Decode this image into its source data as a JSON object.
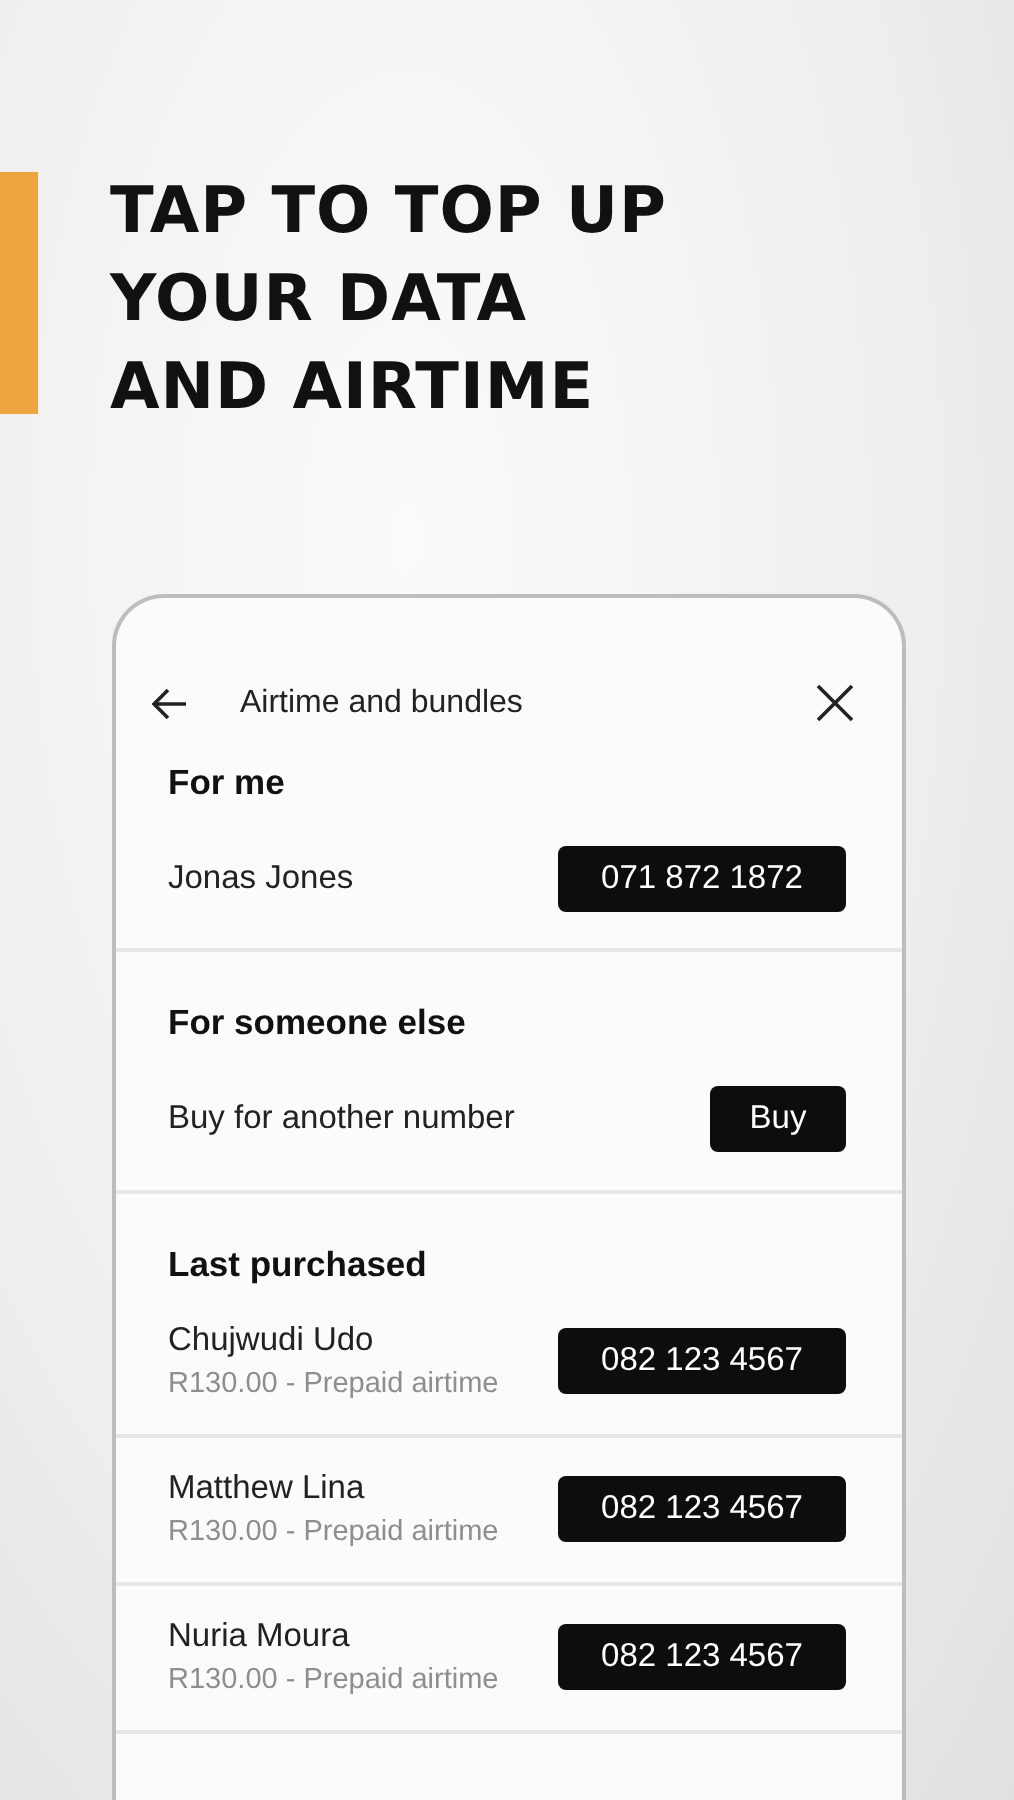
{
  "headline": [
    "TAP TO TOP UP",
    "YOUR DATA",
    "AND AIRTIME"
  ],
  "screen": {
    "title": "Airtime and bundles",
    "sections": [
      {
        "heading": "For me",
        "rows": [
          {
            "name": "Jonas Jones",
            "action": "071 872 1872"
          }
        ]
      },
      {
        "heading": "For someone else",
        "rows": [
          {
            "name": "Buy for another number",
            "action": "Buy"
          }
        ]
      },
      {
        "heading": "Last purchased",
        "rows": [
          {
            "name": "Chujwudi Udo",
            "detail": "R130.00 - Prepaid airtime",
            "action": "082 123 4567"
          },
          {
            "name": "Matthew Lina",
            "detail": "R130.00 - Prepaid airtime",
            "action": "082 123 4567"
          },
          {
            "name": "Nuria Moura",
            "detail": "R130.00 - Prepaid airtime",
            "action": "082 123 4567"
          }
        ]
      }
    ]
  }
}
